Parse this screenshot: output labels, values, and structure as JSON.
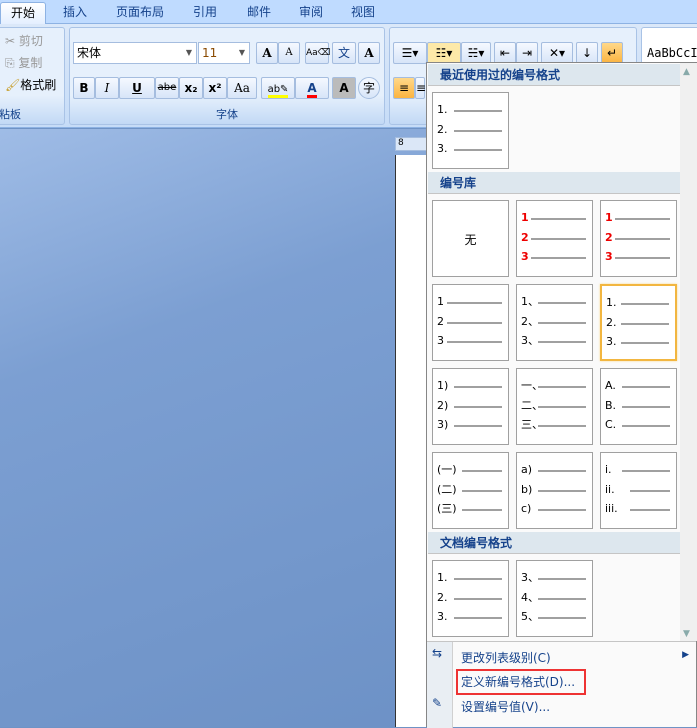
{
  "tabs": [
    "开始",
    "插入",
    "页面布局",
    "引用",
    "邮件",
    "审阅",
    "视图"
  ],
  "clipboard": {
    "cut": "剪切",
    "copy": "复制",
    "format_painter": "格式刷",
    "label": "粘板"
  },
  "font": {
    "name": "宋体",
    "size": "11",
    "label": "字体",
    "bold": "B",
    "italic": "I",
    "underline": "U",
    "strike": "abe",
    "sub": "x₂",
    "sup": "x²",
    "case": "Aa",
    "grow": "A",
    "shrink": "A",
    "color_a": "A",
    "shade_a": "A",
    "enclose": "字",
    "phonetic": "文"
  },
  "colors": {
    "highlight": "#ffff00",
    "font_color": "#ff0000",
    "accent": "#15428b"
  },
  "styles": {
    "preview": "AaBbCcI"
  },
  "ruler": {
    "mark": "8"
  },
  "menu": {
    "recent_header": "最近使用过的编号格式",
    "recent": [
      {
        "nums": [
          "1.",
          "2.",
          "3."
        ]
      }
    ],
    "library_header": "编号库",
    "none_label": "无",
    "library": [
      {
        "none": true
      },
      {
        "nums": [
          "1",
          "2",
          "3"
        ],
        "red": true
      },
      {
        "nums": [
          "1",
          "2",
          "3"
        ],
        "red": true
      },
      {
        "nums": [
          "1",
          "2",
          "3"
        ]
      },
      {
        "nums": [
          "1、",
          "2、",
          "3、"
        ]
      },
      {
        "nums": [
          "1.",
          "2.",
          "3."
        ],
        "selected": true
      },
      {
        "nums": [
          "1)",
          "2)",
          "3)"
        ]
      },
      {
        "nums": [
          "一、",
          "二、",
          "三、"
        ]
      },
      {
        "nums": [
          "A.",
          "B.",
          "C."
        ]
      },
      {
        "nums": [
          "(一)",
          "(二)",
          "(三)"
        ]
      },
      {
        "nums": [
          "a)",
          "b)",
          "c)"
        ]
      },
      {
        "nums": [
          "i.",
          "ii.",
          "iii."
        ]
      }
    ],
    "doc_header": "文档编号格式",
    "doc": [
      {
        "nums": [
          "1.",
          "2.",
          "3."
        ]
      },
      {
        "nums": [
          "3、",
          "4、",
          "5、"
        ]
      }
    ],
    "items": {
      "change_level": "更改列表级别(C)",
      "define_new": "定义新编号格式(D)...",
      "set_value": "设置编号值(V)..."
    },
    "highlight_color": "#ee3333"
  }
}
